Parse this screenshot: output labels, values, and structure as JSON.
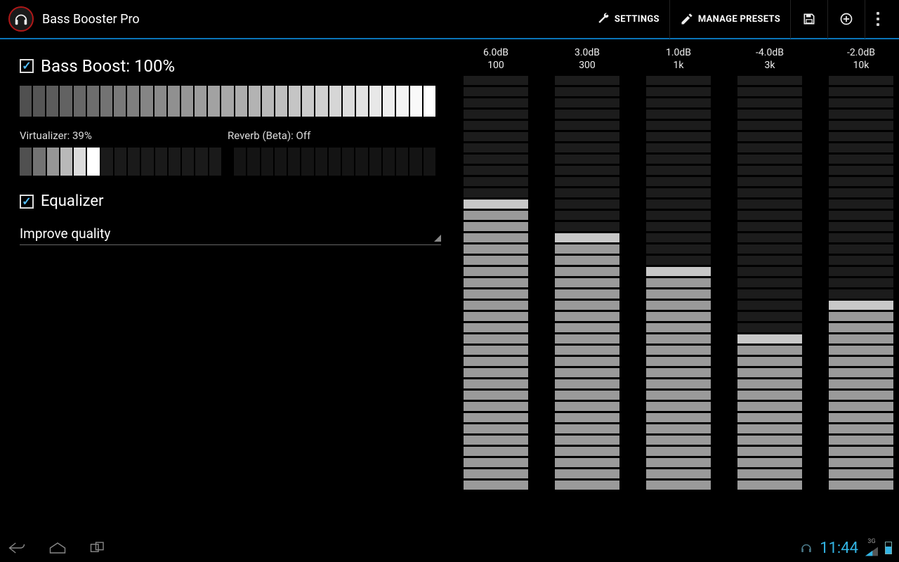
{
  "app": {
    "title": "Bass Booster Pro"
  },
  "toolbar": {
    "settings": "SETTINGS",
    "manage_presets": "MANAGE PRESETS"
  },
  "bass_boost": {
    "label": "Bass Boost: 100%",
    "checked": true,
    "percent": 100,
    "segments": 31
  },
  "virtualizer": {
    "label": "Virtualizer: 39%",
    "percent": 39,
    "segments": 15
  },
  "reverb": {
    "label": "Reverb (Beta): Off",
    "value": "Off",
    "percent": 0,
    "segments": 15
  },
  "equalizer": {
    "label": "Equalizer",
    "checked": true,
    "preset": "Improve quality",
    "bands": [
      {
        "db": "6.0dB",
        "freq": "100",
        "value": 6.0
      },
      {
        "db": "3.0dB",
        "freq": "300",
        "value": 3.0
      },
      {
        "db": "1.0dB",
        "freq": "1k",
        "value": 1.0
      },
      {
        "db": "-4.0dB",
        "freq": "3k",
        "value": -4.0
      },
      {
        "db": "-2.0dB",
        "freq": "10k",
        "value": -2.0
      }
    ],
    "band_segments": 37,
    "db_range": [
      -15,
      15
    ]
  },
  "status_bar": {
    "clock": "11:44",
    "network": "3G"
  }
}
